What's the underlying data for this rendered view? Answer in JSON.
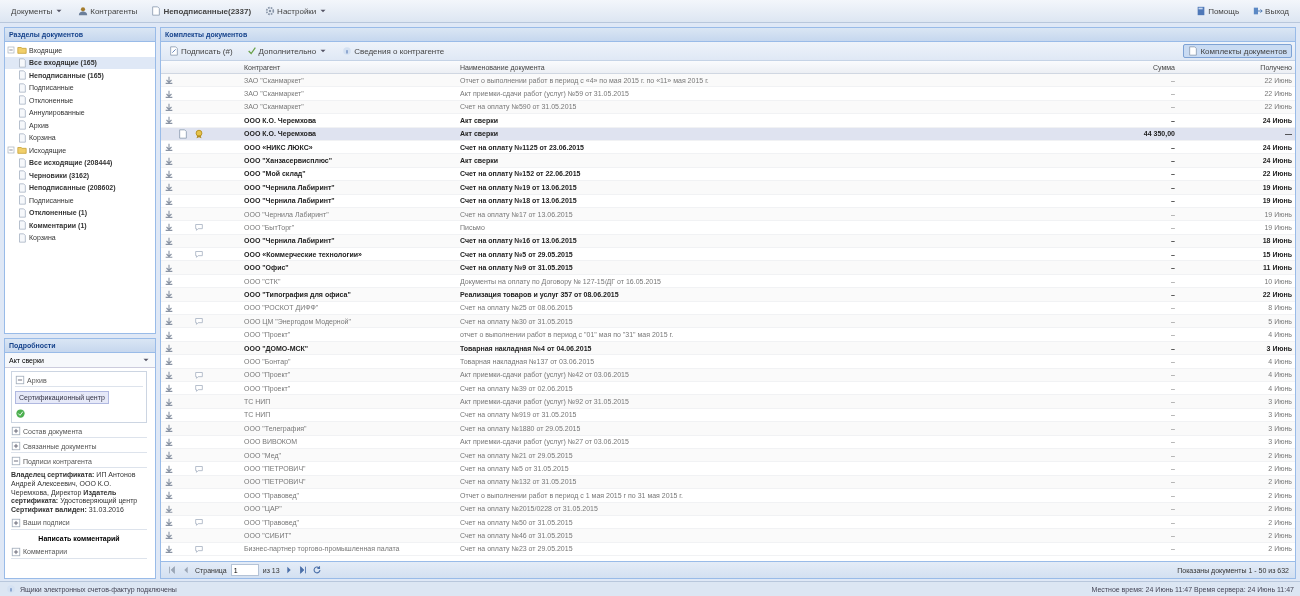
{
  "top_menu": [
    {
      "label": "Документы",
      "dropdown": true,
      "bold": false
    },
    {
      "label": "Контрагенты",
      "dropdown": false,
      "bold": false
    },
    {
      "label": "Неподписанные(2337)",
      "dropdown": false,
      "bold": true
    },
    {
      "label": "Настройки",
      "dropdown": true,
      "bold": false
    }
  ],
  "top_right": [
    {
      "label": "Помощь"
    },
    {
      "label": "Выход"
    }
  ],
  "sections_panel": {
    "title": "Разделы документов",
    "tree": [
      {
        "label": "Входящие",
        "bold": false,
        "selected": false,
        "expanded": true,
        "children": [
          {
            "label": "Все входящие (165)",
            "bold": true,
            "selected": true
          },
          {
            "label": "Неподписанные (165)",
            "bold": true,
            "selected": false
          },
          {
            "label": "Подписанные",
            "bold": false,
            "selected": false
          },
          {
            "label": "Отклоненные",
            "bold": false,
            "selected": false
          },
          {
            "label": "Аннулированные",
            "bold": false,
            "selected": false
          },
          {
            "label": "Архив",
            "bold": false,
            "selected": false
          },
          {
            "label": "Корзина",
            "bold": false,
            "selected": false
          }
        ]
      },
      {
        "label": "Исходящие",
        "bold": false,
        "selected": false,
        "expanded": true,
        "children": [
          {
            "label": "Все исходящие (208444)",
            "bold": true,
            "selected": false
          },
          {
            "label": "Черновики (3162)",
            "bold": true,
            "selected": false
          },
          {
            "label": "Неподписанные (208602)",
            "bold": true,
            "selected": false
          },
          {
            "label": "Подписанные",
            "bold": false,
            "selected": false
          },
          {
            "label": "Отклоненные (1)",
            "bold": true,
            "selected": false
          },
          {
            "label": "Комментарии (1)",
            "bold": true,
            "selected": false
          },
          {
            "label": "Корзина",
            "bold": false,
            "selected": false
          }
        ]
      }
    ]
  },
  "details_panel": {
    "title": "Подробности",
    "doc_select": "Акт сверки",
    "image_section": "Архив",
    "stamp": "Сертификационный центр",
    "sections": [
      {
        "label": "Состав документа",
        "expanded": false
      },
      {
        "label": "Связанные документы",
        "expanded": false
      },
      {
        "label": "Подписи контрагента",
        "expanded": true
      }
    ],
    "cert_lines": [
      {
        "term": "Владелец сертификата:",
        "value": "ИП Антонов Андрей Алексеевич, ООО К.О. Черемхова, Директор"
      },
      {
        "term": "Издатель сертификата:",
        "value": "Удостоверяющий центр"
      },
      {
        "term": "Сертификат валиден:",
        "value": "31.03.2016"
      }
    ],
    "own_signatures": "Ваши подписи",
    "comment_button": "Написать комментарий",
    "comments": "Комментарии"
  },
  "grid": {
    "title": "Комплекты документов",
    "toolbar": [
      {
        "label": "Подписать (#)",
        "dropdown": false
      },
      {
        "label": "Дополнительно",
        "dropdown": true
      },
      {
        "label": "Сведения о контрагенте",
        "dropdown": false
      }
    ],
    "toggle_button": {
      "label": "Комплекты документов",
      "selected": true
    },
    "columns": [
      "Контрагент",
      "Наименование документа",
      "Сумма",
      "Получено"
    ],
    "rows": [
      {
        "kind": "received",
        "comment": false,
        "unread": false,
        "selected": false,
        "counterparty": "ЗАО \"Сканмаркет\"",
        "document": "Отчет о выполнении работ в период с «4» по мая 2015 г. по «11» мая 2015 г.",
        "amount": "–",
        "date": "22 Июнь"
      },
      {
        "kind": "received",
        "comment": false,
        "unread": false,
        "selected": false,
        "counterparty": "ЗАО \"Сканмаркет\"",
        "document": "Акт приемки-сдачи работ (услуг) №59 от 31.05.2015",
        "amount": "–",
        "date": "22 Июнь"
      },
      {
        "kind": "received",
        "comment": false,
        "unread": false,
        "selected": false,
        "counterparty": "ЗАО \"Сканмаркет\"",
        "document": "Счет на оплату №590 от 31.05.2015",
        "amount": "–",
        "date": "22 Июнь"
      },
      {
        "kind": "received",
        "comment": false,
        "unread": true,
        "selected": false,
        "counterparty": "ООО К.О. Черемхова",
        "document": "Акт сверки",
        "amount": "–",
        "date": "24 Июнь"
      },
      {
        "kind": "signed",
        "comment": false,
        "unread": true,
        "selected": true,
        "counterparty": "ООО К.О. Черемхова",
        "document": "Акт сверки",
        "amount": "44 350,00",
        "date": "—"
      },
      {
        "kind": "received",
        "comment": false,
        "unread": true,
        "selected": false,
        "counterparty": "ООО «НИКС ЛЮКС»",
        "document": "Счет на оплату №1125 от 23.06.2015",
        "amount": "–",
        "date": "24 Июнь"
      },
      {
        "kind": "received",
        "comment": false,
        "unread": true,
        "selected": false,
        "counterparty": "ООО \"Ханзасервисплюс\"",
        "document": "Акт сверки",
        "amount": "–",
        "date": "24 Июнь"
      },
      {
        "kind": "received",
        "comment": false,
        "unread": true,
        "selected": false,
        "counterparty": "ООО \"Мой склад\"",
        "document": "Счет на оплату №152 от 22.06.2015",
        "amount": "–",
        "date": "22 Июнь"
      },
      {
        "kind": "received",
        "comment": false,
        "unread": true,
        "selected": false,
        "counterparty": "ООО \"Чернила Лабиринт\"",
        "document": "Счет на оплату №19 от 13.06.2015",
        "amount": "–",
        "date": "19 Июнь"
      },
      {
        "kind": "received",
        "comment": false,
        "unread": true,
        "selected": false,
        "counterparty": "ООО \"Чернила Лабиринт\"",
        "document": "Счет на оплату №18 от 13.06.2015",
        "amount": "–",
        "date": "19 Июнь"
      },
      {
        "kind": "received",
        "comment": false,
        "unread": false,
        "selected": false,
        "counterparty": "ООО \"Чернила Лабиринт\"",
        "document": "Счет на оплату №17 от 13.06.2015",
        "amount": "–",
        "date": "19 Июнь"
      },
      {
        "kind": "received",
        "comment": true,
        "unread": false,
        "selected": false,
        "counterparty": "ООО \"БытТорг\"",
        "document": "Письмо",
        "amount": "–",
        "date": "19 Июнь"
      },
      {
        "kind": "received",
        "comment": false,
        "unread": true,
        "selected": false,
        "counterparty": "ООО \"Чернила Лабиринт\"",
        "document": "Счет на оплату №16 от 13.06.2015",
        "amount": "–",
        "date": "18 Июнь"
      },
      {
        "kind": "received",
        "comment": true,
        "unread": true,
        "selected": false,
        "counterparty": "ООО «Коммерческие технологии»",
        "document": "Счет на оплату №5 от 29.05.2015",
        "amount": "–",
        "date": "15 Июнь"
      },
      {
        "kind": "received",
        "comment": false,
        "unread": true,
        "selected": false,
        "counterparty": "ООО \"Офис\"",
        "document": "Счет на оплату №9 от 31.05.2015",
        "amount": "–",
        "date": "11 Июнь"
      },
      {
        "kind": "received",
        "comment": false,
        "unread": false,
        "selected": false,
        "counterparty": "ООО \"СТК\"",
        "document": "Документы на оплату по Договору № 127-15/ДГ от 16.05.2015",
        "amount": "–",
        "date": "10 Июнь"
      },
      {
        "kind": "received",
        "comment": false,
        "unread": true,
        "selected": false,
        "counterparty": "ООО \"Типография для офиса\"",
        "document": "Реализация товаров и услуг 357 от 08.06.2015",
        "amount": "–",
        "date": "22 Июнь"
      },
      {
        "kind": "received",
        "comment": false,
        "unread": false,
        "selected": false,
        "counterparty": "ООО \"РОСКОТ ДИФФ\"",
        "document": "Счет на оплату №25 от 08.06.2015",
        "amount": "–",
        "date": "8 Июнь"
      },
      {
        "kind": "received",
        "comment": true,
        "unread": false,
        "selected": false,
        "counterparty": "ООО ЦМ \"Энергодом Модерной\"",
        "document": "Счет на оплату №30 от 31.05.2015",
        "amount": "–",
        "date": "5 Июнь"
      },
      {
        "kind": "received",
        "comment": false,
        "unread": false,
        "selected": false,
        "counterparty": "ООО \"Проект\"",
        "document": "отчет о выполнении работ в период с \"01\" мая по \"31\" мая 2015 г.",
        "amount": "–",
        "date": "4 Июнь"
      },
      {
        "kind": "received",
        "comment": false,
        "unread": true,
        "selected": false,
        "counterparty": "ООО \"ДОМО-МСК\"",
        "document": "Товарная накладная №4 от 04.06.2015",
        "amount": "–",
        "date": "3 Июнь"
      },
      {
        "kind": "received",
        "comment": false,
        "unread": false,
        "selected": false,
        "counterparty": "ООО \"Бонтар\"",
        "document": "Товарная накладная №137 от 03.06.2015",
        "amount": "–",
        "date": "4 Июнь"
      },
      {
        "kind": "received",
        "comment": true,
        "unread": false,
        "selected": false,
        "counterparty": "ООО \"Проект\"",
        "document": "Акт приемки-сдачи работ (услуг) №42 от 03.06.2015",
        "amount": "–",
        "date": "4 Июнь"
      },
      {
        "kind": "received",
        "comment": true,
        "unread": false,
        "selected": false,
        "counterparty": "ООО \"Проект\"",
        "document": "Счет на оплату №39 от 02.06.2015",
        "amount": "–",
        "date": "4 Июнь"
      },
      {
        "kind": "received",
        "comment": false,
        "unread": false,
        "selected": false,
        "counterparty": "ТС НИП",
        "document": "Акт приемки-сдачи работ (услуг) №92 от 31.05.2015",
        "amount": "–",
        "date": "3 Июнь"
      },
      {
        "kind": "received",
        "comment": false,
        "unread": false,
        "selected": false,
        "counterparty": "ТС НИП",
        "document": "Счет на оплату №919 от 31.05.2015",
        "amount": "–",
        "date": "3 Июнь"
      },
      {
        "kind": "received",
        "comment": false,
        "unread": false,
        "selected": false,
        "counterparty": "ООО \"Телеграфия\"",
        "document": "Счет на оплату №1880 от 29.05.2015",
        "amount": "–",
        "date": "3 Июнь"
      },
      {
        "kind": "received",
        "comment": false,
        "unread": false,
        "selected": false,
        "counterparty": "ООО ВИВОКОМ",
        "document": "Акт приемки-сдачи работ (услуг) №27 от 03.06.2015",
        "amount": "–",
        "date": "3 Июнь"
      },
      {
        "kind": "received",
        "comment": false,
        "unread": false,
        "selected": false,
        "counterparty": "ООО \"Мед\"",
        "document": "Счет на оплату №21 от 29.05.2015",
        "amount": "–",
        "date": "2 Июнь"
      },
      {
        "kind": "received",
        "comment": true,
        "unread": false,
        "selected": false,
        "counterparty": "ООО \"ПЕТРОВИЧ\"",
        "document": "Счет на оплату №5 от 31.05.2015",
        "amount": "–",
        "date": "2 Июнь"
      },
      {
        "kind": "received",
        "comment": false,
        "unread": false,
        "selected": false,
        "counterparty": "ООО \"ПЕТРОВИЧ\"",
        "document": "Счет на оплату №132 от 31.05.2015",
        "amount": "–",
        "date": "2 Июнь"
      },
      {
        "kind": "received",
        "comment": false,
        "unread": false,
        "selected": false,
        "counterparty": "ООО \"Правовед\"",
        "document": "Отчет о выполнении работ в период с 1 мая 2015 г по 31 мая 2015 г.",
        "amount": "–",
        "date": "2 Июнь"
      },
      {
        "kind": "received",
        "comment": false,
        "unread": false,
        "selected": false,
        "counterparty": "ООО \"ЦАР\"",
        "document": "Счет на оплату №2015/0228 от 31.05.2015",
        "amount": "–",
        "date": "2 Июнь"
      },
      {
        "kind": "received",
        "comment": true,
        "unread": false,
        "selected": false,
        "counterparty": "ООО \"Правовед\"",
        "document": "Счет на оплату №50 от 31.05.2015",
        "amount": "–",
        "date": "2 Июнь"
      },
      {
        "kind": "received",
        "comment": false,
        "unread": false,
        "selected": false,
        "counterparty": "ООО \"СИБИТ\"",
        "document": "Счет на оплату №46 от 31.05.2015",
        "amount": "–",
        "date": "2 Июнь"
      },
      {
        "kind": "received",
        "comment": true,
        "unread": false,
        "selected": false,
        "counterparty": "Бизнес-партнер торгово-промышленная палата",
        "document": "Счет на оплату №23 от 29.05.2015",
        "amount": "–",
        "date": "2 Июнь"
      }
    ],
    "pager": {
      "page_label": "Страница",
      "page": "1",
      "of": "из 13"
    },
    "summary": "Показаны документы 1 - 50 из 632"
  },
  "status_bar": {
    "left": "Ящики электронных счетов-фактур подключены",
    "right": "Местное время: 24 Июнь 11:47 Время сервера: 24 Июнь 11:47"
  }
}
